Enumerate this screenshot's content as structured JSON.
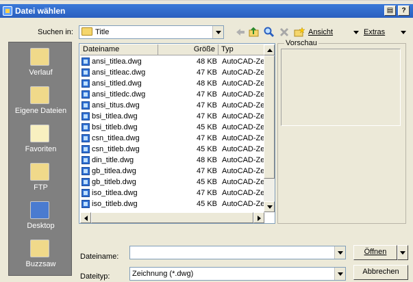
{
  "window": {
    "title": "Datei wählen"
  },
  "lookin": {
    "label": "Suchen in:",
    "value": "Title"
  },
  "toolbar": {
    "view_label": "Ansicht",
    "extras_label": "Extras"
  },
  "places": [
    {
      "label": "Verlauf"
    },
    {
      "label": "Eigene Dateien"
    },
    {
      "label": "Favoriten"
    },
    {
      "label": "FTP"
    },
    {
      "label": "Desktop"
    },
    {
      "label": "Buzzsaw"
    }
  ],
  "filelist": {
    "columns": [
      "Dateiname",
      "Größe",
      "Typ"
    ],
    "rows": [
      {
        "name": "ansi_titlea.dwg",
        "size": "48 KB",
        "type": "AutoCAD-Zeic"
      },
      {
        "name": "ansi_titleac.dwg",
        "size": "47 KB",
        "type": "AutoCAD-Zeic"
      },
      {
        "name": "ansi_titled.dwg",
        "size": "48 KB",
        "type": "AutoCAD-Zeic"
      },
      {
        "name": "ansi_titledc.dwg",
        "size": "47 KB",
        "type": "AutoCAD-Zeic"
      },
      {
        "name": "ansi_titus.dwg",
        "size": "47 KB",
        "type": "AutoCAD-Zeic"
      },
      {
        "name": "bsi_titlea.dwg",
        "size": "47 KB",
        "type": "AutoCAD-Zeic"
      },
      {
        "name": "bsi_titleb.dwg",
        "size": "45 KB",
        "type": "AutoCAD-Zeic"
      },
      {
        "name": "csn_titlea.dwg",
        "size": "47 KB",
        "type": "AutoCAD-Zeic"
      },
      {
        "name": "csn_titleb.dwg",
        "size": "45 KB",
        "type": "AutoCAD-Zeic"
      },
      {
        "name": "din_title.dwg",
        "size": "48 KB",
        "type": "AutoCAD-Zeic"
      },
      {
        "name": "gb_titlea.dwg",
        "size": "47 KB",
        "type": "AutoCAD-Zeic"
      },
      {
        "name": "gb_titleb.dwg",
        "size": "45 KB",
        "type": "AutoCAD-Zeic"
      },
      {
        "name": "iso_titlea.dwg",
        "size": "47 KB",
        "type": "AutoCAD-Zeic"
      },
      {
        "name": "iso_titleb.dwg",
        "size": "45 KB",
        "type": "AutoCAD-Zeic"
      }
    ]
  },
  "preview": {
    "label": "Vorschau"
  },
  "filename": {
    "label": "Dateiname:",
    "value": ""
  },
  "filetype": {
    "label": "Dateityp:",
    "value": "Zeichnung (*.dwg)"
  },
  "buttons": {
    "open_label": "Öffnen",
    "cancel_label": "Abbrechen"
  },
  "colors": {
    "titlebar": "#2a5fbf",
    "dialog_bg": "#ece9d8",
    "places_bg": "#808080"
  }
}
